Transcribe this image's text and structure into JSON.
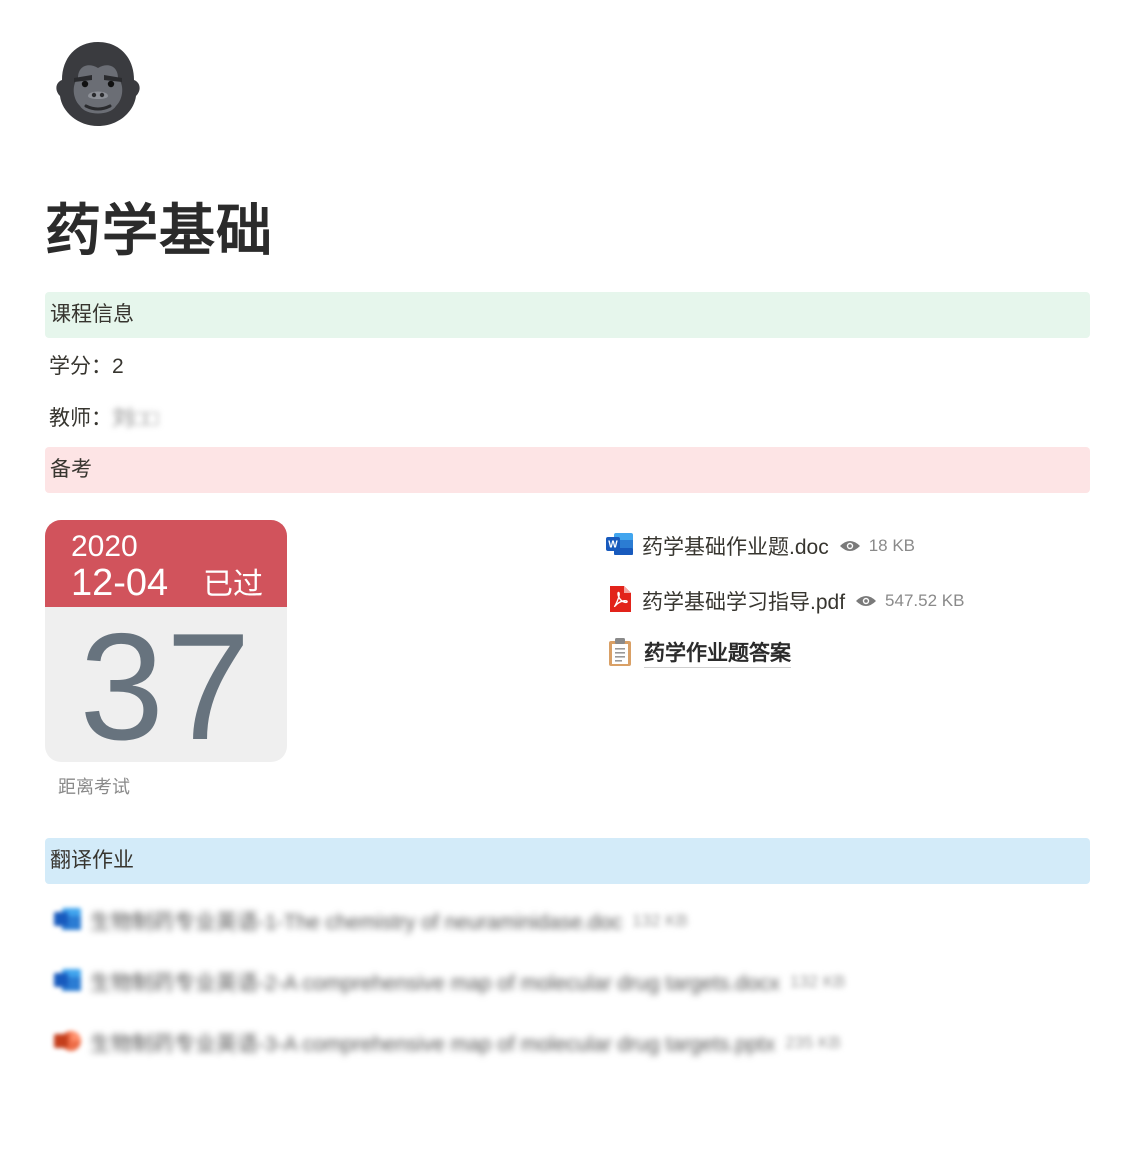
{
  "page": {
    "icon": "gorilla-emoji-icon",
    "title": "药学基础"
  },
  "course_info": {
    "heading": "课程信息",
    "credit_label": "学分：",
    "credit_value": "2",
    "teacher_label": "教师：",
    "teacher_value": "刘□□"
  },
  "exam_prep": {
    "heading": "备考",
    "calendar": {
      "year": "2020",
      "date": "12-04",
      "status": "已过",
      "days": "37",
      "caption": "距离考试"
    },
    "files": [
      {
        "name": "药学基础作业题.doc",
        "size": "18 KB",
        "icon": "word-doc-icon"
      },
      {
        "name": "药学基础学习指导.pdf",
        "size": "547.52 KB",
        "icon": "pdf-icon"
      }
    ],
    "page_link": {
      "name": "药学作业题答案",
      "icon": "clipboard-icon"
    }
  },
  "translation": {
    "heading": "翻译作业",
    "files": [
      {
        "name": "生物制药专业英语-1-The chemistry of neuraminidase.doc",
        "size": "132 KB",
        "icon": "word-doc-icon"
      },
      {
        "name": "生物制药专业英语-2-A comprehensive map of molecular drug targets.docx",
        "size": "132 KB",
        "icon": "word-doc-icon"
      },
      {
        "name": "生物制药专业英语-3-A comprehensive map of molecular drug targets.pptx",
        "size": "235 KB",
        "icon": "powerpoint-icon"
      }
    ]
  },
  "colors": {
    "green_callout": "#e6f6ec",
    "red_callout": "#fde4e5",
    "blue_callout": "#d3ebf9",
    "calendar_header": "#d1535c",
    "calendar_number": "#67737e"
  }
}
